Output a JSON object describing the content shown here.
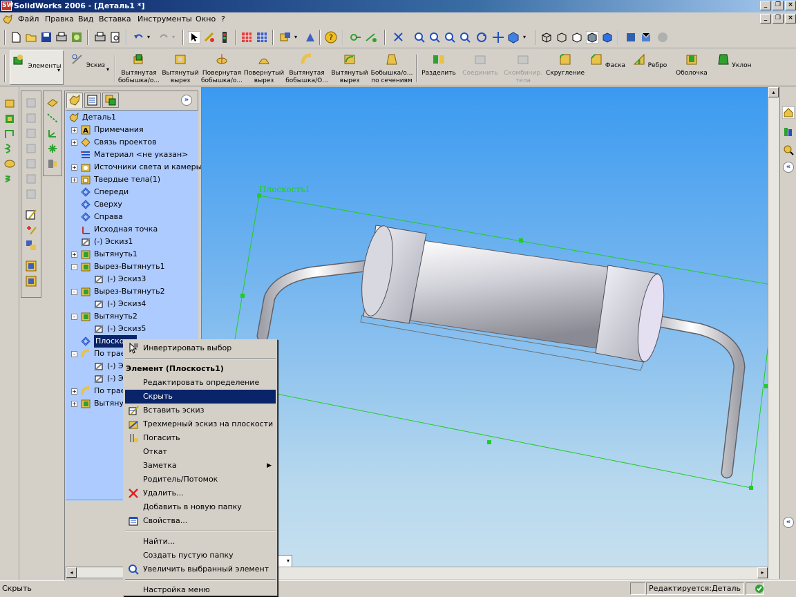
{
  "window": {
    "title": "SolidWorks 2006 - [Деталь1 *]",
    "app_icon_text": "SW"
  },
  "menu": [
    "Файл",
    "Правка",
    "Вид",
    "Вставка",
    "Инструменты",
    "Окно",
    "?"
  ],
  "features_toolbar": {
    "mode_buttons": [
      "Элементы",
      "Эскиз"
    ],
    "buttons": [
      {
        "label": "Вытянутая бобышка/о...",
        "enabled": true
      },
      {
        "label": "Вытянутый вырез",
        "enabled": true
      },
      {
        "label": "Повернутая бобышка/о...",
        "enabled": true
      },
      {
        "label": "Повернутый вырез",
        "enabled": true
      },
      {
        "label": "Вытянутая бобышка/О...",
        "enabled": true
      },
      {
        "label": "Вытянутый вырез",
        "enabled": true
      },
      {
        "label": "Бобышка/о... по сечениям",
        "enabled": true
      },
      {
        "label": "Разделить",
        "enabled": true
      },
      {
        "label": "Соединить",
        "enabled": false
      },
      {
        "label": "Скомбинир. тела",
        "enabled": false
      },
      {
        "label": "Скругление",
        "enabled": true
      },
      {
        "label": "Фаска",
        "enabled": true
      },
      {
        "label": "Ребро",
        "enabled": true
      },
      {
        "label": "Оболочка",
        "enabled": true
      },
      {
        "label": "Уклон",
        "enabled": true
      }
    ]
  },
  "tree": {
    "root": "Деталь1",
    "items": [
      {
        "label": "Примечания",
        "expander": "+",
        "indent": 0
      },
      {
        "label": "Связь проектов",
        "expander": "+",
        "indent": 0
      },
      {
        "label": "Материал <не указан>",
        "expander": "",
        "indent": 0
      },
      {
        "label": "Источники света и камеры",
        "expander": "+",
        "indent": 0
      },
      {
        "label": "Твердые тела(1)",
        "expander": "+",
        "indent": 0
      },
      {
        "label": "Спереди",
        "expander": "",
        "indent": 0
      },
      {
        "label": "Сверху",
        "expander": "",
        "indent": 0
      },
      {
        "label": "Справа",
        "expander": "",
        "indent": 0
      },
      {
        "label": "Исходная точка",
        "expander": "",
        "indent": 0
      },
      {
        "label": "(-) Эскиз1",
        "expander": "",
        "indent": 0
      },
      {
        "label": "Вытянуть1",
        "expander": "+",
        "indent": 0
      },
      {
        "label": "Вырез-Вытянуть1",
        "expander": "-",
        "indent": 0
      },
      {
        "label": "(-) Эскиз3",
        "expander": "",
        "indent": 1
      },
      {
        "label": "Вырез-Вытянуть2",
        "expander": "-",
        "indent": 0
      },
      {
        "label": "(-) Эскиз4",
        "expander": "",
        "indent": 1
      },
      {
        "label": "Вытянуть2",
        "expander": "-",
        "indent": 0
      },
      {
        "label": "(-) Эскиз5",
        "expander": "",
        "indent": 1
      },
      {
        "label": "Плоскос...",
        "expander": "",
        "indent": 0,
        "selected": true
      },
      {
        "label": "По трае...",
        "expander": "-",
        "indent": 0
      },
      {
        "label": "(-) Э...",
        "expander": "",
        "indent": 1
      },
      {
        "label": "(-) Э...",
        "expander": "",
        "indent": 1
      },
      {
        "label": "По трае...",
        "expander": "+",
        "indent": 0
      },
      {
        "label": "Вытяну...",
        "expander": "+",
        "indent": 0
      }
    ]
  },
  "viewport": {
    "plane_label": "Плоскость1"
  },
  "context_menu": {
    "items": [
      {
        "type": "item",
        "label": "Инвертировать выбор",
        "icon": "cursor-icon"
      },
      {
        "type": "sep"
      },
      {
        "type": "header",
        "label": "Элемент (Плоскость1)"
      },
      {
        "type": "item",
        "label": "Редактировать определение"
      },
      {
        "type": "item",
        "label": "Скрыть",
        "highlight": true
      },
      {
        "type": "item",
        "label": "Вставить эскиз",
        "icon": "sketch-icon"
      },
      {
        "type": "item",
        "label": "Трехмерный эскиз на плоскости",
        "icon": "3d-sketch-icon"
      },
      {
        "type": "item",
        "label": "Погасить",
        "icon": "suppress-icon"
      },
      {
        "type": "item",
        "label": "Откат"
      },
      {
        "type": "item",
        "label": "Заметка",
        "submenu": true
      },
      {
        "type": "item",
        "label": "Родитель/Потомок"
      },
      {
        "type": "item",
        "label": "Удалить...",
        "icon": "delete-icon"
      },
      {
        "type": "item",
        "label": "Добавить в новую папку"
      },
      {
        "type": "item",
        "label": "Свойства...",
        "icon": "properties-icon"
      },
      {
        "type": "sep"
      },
      {
        "type": "item",
        "label": "Найти..."
      },
      {
        "type": "item",
        "label": "Создать пустую папку"
      },
      {
        "type": "item",
        "label": "Увеличить выбранный элемент",
        "icon": "zoom-to-selection-icon"
      },
      {
        "type": "sep"
      },
      {
        "type": "item",
        "label": "Настройка меню"
      }
    ]
  },
  "status": {
    "message": "Скрыть",
    "editing": "Редактируется:Деталь"
  },
  "colors": {
    "selection": "#0a246a",
    "tree_bg": "#aecbff",
    "plane_green": "#22cc22"
  }
}
